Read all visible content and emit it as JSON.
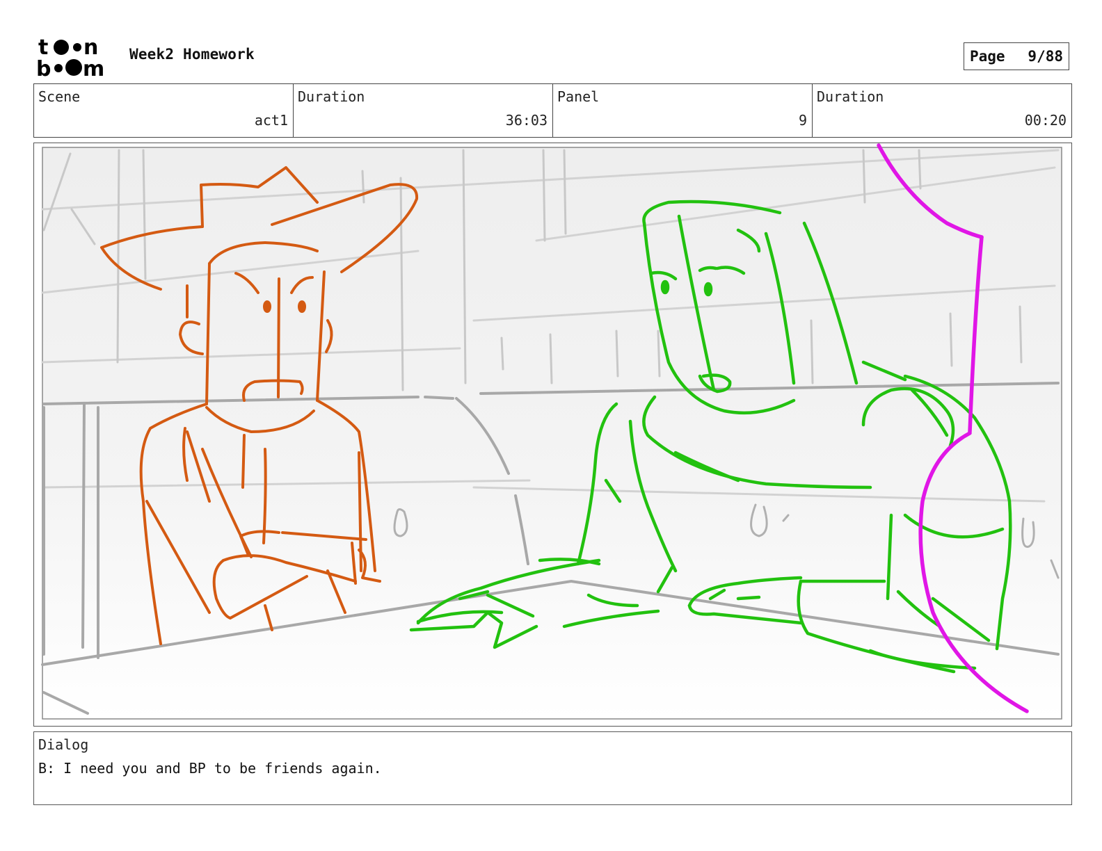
{
  "header": {
    "project_title": "Week2 Homework",
    "logo_text": "toon boom",
    "page_label": "Page",
    "page_value": "9/88"
  },
  "info": {
    "scene_label": "Scene",
    "scene_value": "act1",
    "scene_duration_label": "Duration",
    "scene_duration_value": "36:03",
    "panel_label": "Panel",
    "panel_value": "9",
    "panel_duration_label": "Duration",
    "panel_duration_value": "00:20"
  },
  "dialog": {
    "label": "Dialog",
    "text": "B: I need you and BP to be friends again."
  },
  "colors": {
    "cowboy_sketch": "#d45a12",
    "robot_sketch": "#22c10f",
    "magenta_sketch": "#e016e6",
    "background_sketch": "#a8a8a8"
  }
}
